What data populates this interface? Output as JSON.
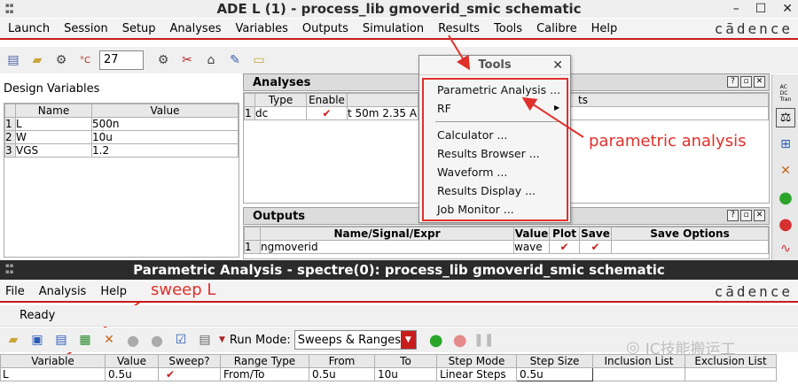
{
  "main_window": {
    "title": "ADE L (1) - process_lib gmoverid_smic schematic",
    "menu": [
      "Launch",
      "Session",
      "Setup",
      "Analyses",
      "Variables",
      "Outputs",
      "Simulation",
      "Results",
      "Tools",
      "Calibre",
      "Help"
    ],
    "brand": "cādence",
    "temperature": "27",
    "temp_unit": "°C"
  },
  "design_variables": {
    "title": "Design Variables",
    "columns": [
      "Name",
      "Value"
    ],
    "rows": [
      {
        "idx": "1",
        "name": "L",
        "value": "500n"
      },
      {
        "idx": "2",
        "name": "W",
        "value": "10u"
      },
      {
        "idx": "3",
        "name": "VGS",
        "value": "1.2"
      }
    ]
  },
  "analyses": {
    "title": "Analyses",
    "columns": [
      "Type",
      "Enable",
      "",
      "ts"
    ],
    "rows": [
      {
        "idx": "1",
        "type": "dc",
        "args": "t 50m 2.35 A"
      }
    ]
  },
  "outputs": {
    "title": "Outputs",
    "columns": [
      "Name/Signal/Expr",
      "Value",
      "Plot",
      "Save",
      "Save Options"
    ],
    "rows": [
      {
        "idx": "1",
        "name": "ngmoverid",
        "value": "wave"
      }
    ]
  },
  "tools_menu": {
    "title": "Tools",
    "items": [
      "Parametric Analysis ...",
      "RF",
      "Calculator ...",
      "Results Browser ...",
      "Waveform ...",
      "Results Display ...",
      "Job Monitor ..."
    ]
  },
  "annotations": {
    "parametric": "parametric analysis",
    "sweep": "sweep L"
  },
  "param_window": {
    "title": "Parametric Analysis - spectre(0): process_lib gmoverid_smic schematic",
    "menu": [
      "File",
      "Analysis",
      "Help"
    ],
    "brand": "cādence",
    "status": "Ready",
    "run_mode_label": "Run Mode:",
    "run_mode_value": "Sweeps & Ranges",
    "columns": [
      "Variable",
      "Value",
      "Sweep?",
      "Range Type",
      "From",
      "To",
      "Step Mode",
      "Step Size",
      "Inclusion List",
      "Exclusion List"
    ],
    "rows": [
      {
        "variable": "L",
        "value": "0.5u",
        "range_type": "From/To",
        "from": "0.5u",
        "to": "10u",
        "step_mode": "Linear Steps",
        "step_size": "0.5u",
        "inclusion": "",
        "exclusion": ""
      }
    ]
  },
  "watermark": "IC技能搬运工"
}
